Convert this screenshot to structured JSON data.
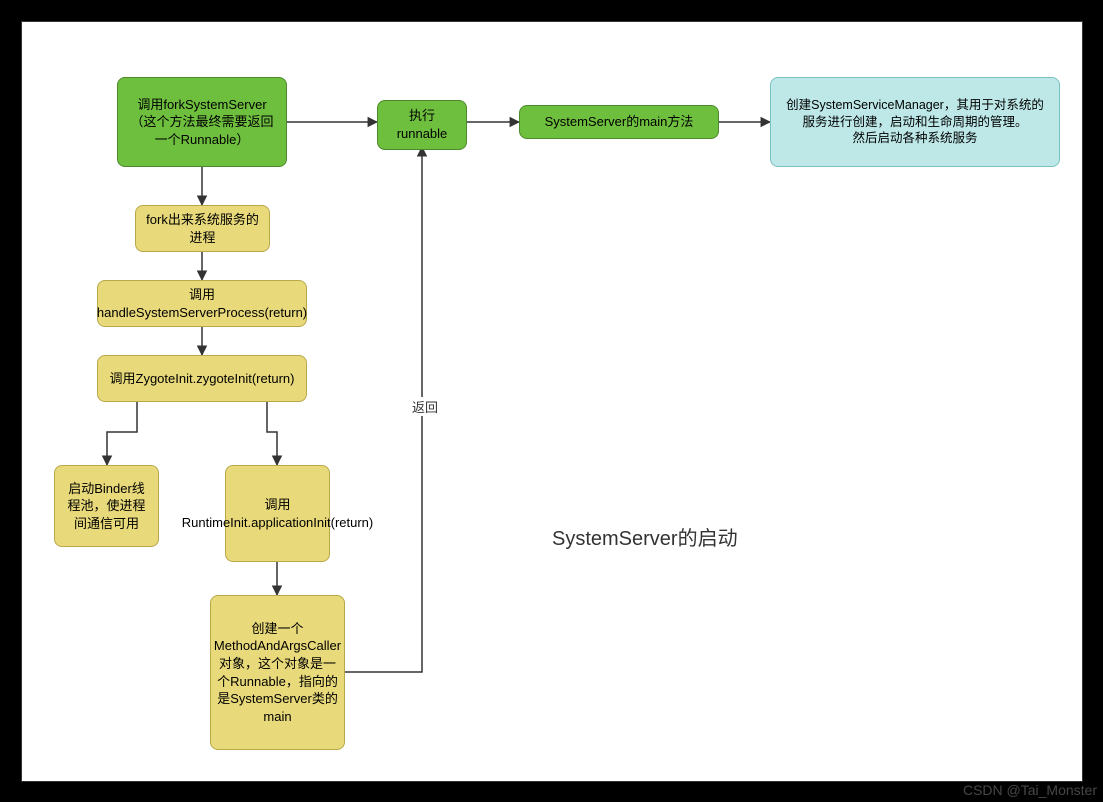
{
  "diagram_title": "SystemServer的启动",
  "watermark": "CSDN @Tai_Monster",
  "nodes": {
    "a": "调用forkSystemServer（这个方法最终需要返回一个Runnable）",
    "b": "执行runnable",
    "c": "SystemServer的main方法",
    "d": "创建SystemServiceManager，其用于对系统的服务进行创建，启动和生命周期的管理。\n然后启动各种系统服务",
    "e": "fork出来系统服务的进程",
    "f": "调用handleSystemServerProcess(return)",
    "g": "调用ZygoteInit.zygoteInit(return)",
    "h": "启动Binder线程池，使进程间通信可用",
    "i": "调用RuntimeInit.applicationInit(return)",
    "j": "创建一个MethodAndArgsCaller对象，这个对象是一个Runnable，指向的是SystemServer类的main"
  },
  "edge_label": "返回",
  "colors": {
    "green": "#6FBF3F",
    "yellow": "#E8D97A",
    "cyan": "#BEE8E8"
  }
}
